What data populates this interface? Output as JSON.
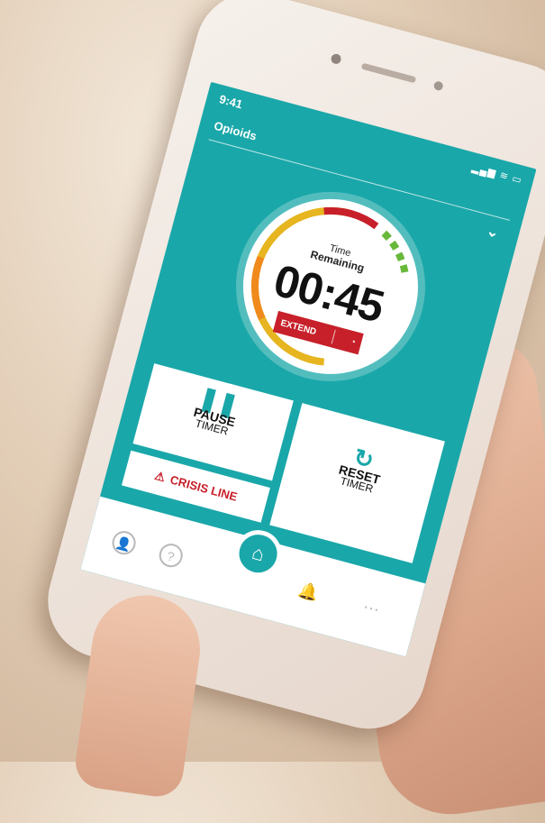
{
  "status_bar": {
    "time": "9:41",
    "icons": "▂▄▆ ≋ ▭"
  },
  "header": {
    "title": "Opioids",
    "chevron": "⌄"
  },
  "timer": {
    "label_top": "Time",
    "label_bottom": "Remaining",
    "value": "00:45",
    "extend_label": "EXTEND",
    "extend_icon": "◔"
  },
  "actions": {
    "pause": {
      "icon": "❚❚",
      "title": "PAUSE",
      "subtitle": "TIMER"
    },
    "reset": {
      "icon": "↻",
      "title": "RESET",
      "subtitle": "TIMER"
    },
    "crisis": {
      "icon": "⚠",
      "label": "CRISIS LINE"
    }
  },
  "tabs": {
    "profile_icon": "👤",
    "help_icon": "?",
    "home_icon": "⌂",
    "bell_icon": "🔔",
    "more_icon": "⋯"
  },
  "colors": {
    "accent": "#1aa7a9",
    "danger": "#c7202a",
    "ring_yellow": "#e6b51f",
    "ring_orange": "#f08a1d",
    "ring_green": "#68b83a"
  }
}
